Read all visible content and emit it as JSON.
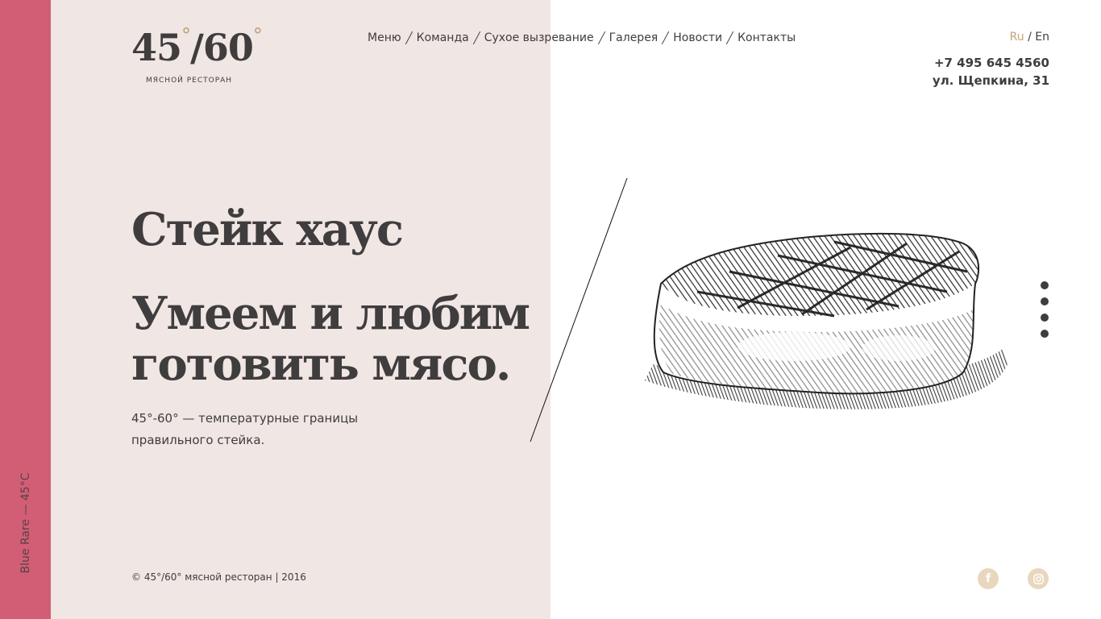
{
  "sidebar": {
    "temperature_label": "Blue Rare — 45°C",
    "accent_color": "#d25e76"
  },
  "brand": {
    "logo_main": "45",
    "logo_slash": "/60",
    "logo_degree": "°",
    "logo_sub": "МЯСНОЙ РЕСТОРАН",
    "accent_color": "#c4a278",
    "panel_color": "#f0e6e4"
  },
  "nav": {
    "items": [
      "Меню",
      "Команда",
      "Сухое вызревание",
      "Галерея",
      "Новости",
      "Контакты"
    ]
  },
  "lang": {
    "ru": "Ru",
    "sep": " / ",
    "en": "En"
  },
  "contacts": {
    "phone": "+7 495 645 4560",
    "address": "ул. Щепкина, 31"
  },
  "hero": {
    "title": "Стейк хаус",
    "slogan_line1": "Умеем и любим",
    "slogan_line2": "готовить мясо.",
    "description": "45°-60° — температурные границы правильного стейка."
  },
  "footer": {
    "copyright": "© 45°/60° мясной ресторан | 2016"
  },
  "slider": {
    "dots": 4
  },
  "social": {
    "icons": [
      "facebook-icon",
      "instagram-icon"
    ]
  }
}
